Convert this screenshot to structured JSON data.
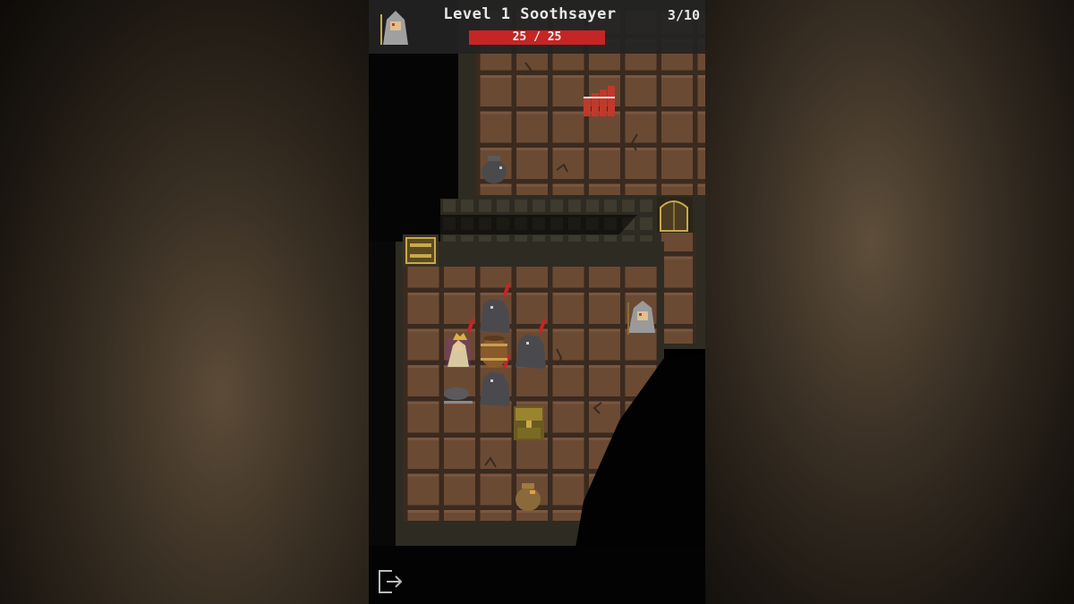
{
  "hud": {
    "title": "Level 1 Soothsayer",
    "hp_text": "25 / 25",
    "hp_current": 25,
    "hp_max": 25,
    "depth": "3/10"
  },
  "colors": {
    "floor": "#6b4a33",
    "grout": "#3a2a1f",
    "wall": "#3e3a2e",
    "hp_red": "#c62525",
    "hud_bg": "#232323"
  },
  "icons": {
    "player": "hooded-mage-icon",
    "exit": "exit-door-icon"
  }
}
